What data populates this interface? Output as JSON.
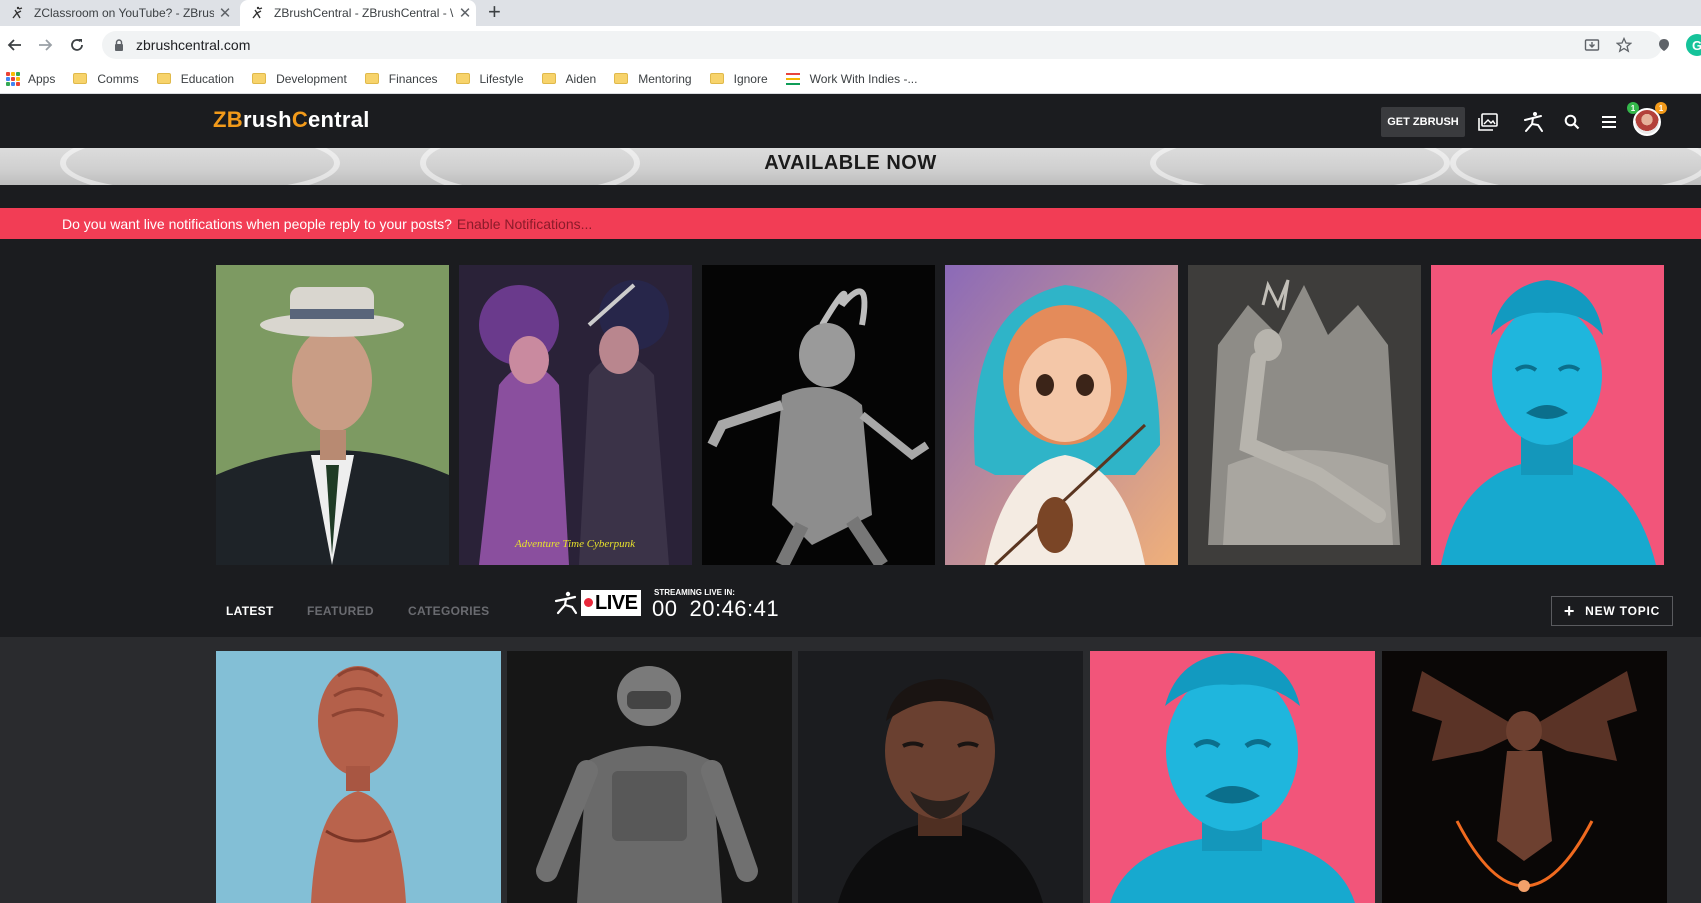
{
  "browser": {
    "tabs": [
      {
        "title": "ZClassroom on YouTube? - ZBrus",
        "active": false
      },
      {
        "title": "ZBrushCentral - ZBrushCentral - \\",
        "active": true
      }
    ],
    "new_tab": "+",
    "url": "zbrushcentral.com",
    "grammarly": "G",
    "bookmarks": {
      "apps": "Apps",
      "items": [
        "Comms",
        "Education",
        "Development",
        "Finances",
        "Lifestyle",
        "Aiden",
        "Mentoring",
        "Ignore"
      ],
      "sheet": "Work With Indies -..."
    }
  },
  "header": {
    "logo_left": "ZB",
    "logo_mid": "rush",
    "logo_c": "C",
    "logo_right": "entral",
    "get_zbrush": "GET ZBRUSH",
    "badges": [
      "1",
      "1"
    ],
    "colors": {
      "logo_accent": "#f29a1a",
      "badge_green": "#34b84b",
      "badge_orange": "#f29a1a"
    }
  },
  "banner": {
    "text": "AVAILABLE NOW"
  },
  "notification": {
    "question": "Do you want live notifications when people reply to your posts?",
    "link": "Enable Notifications..."
  },
  "gallery": {
    "items": [
      {
        "name": "portrait-man-hat"
      },
      {
        "name": "cyberpunk-women",
        "caption": "Adventure Time Cyberpunk"
      },
      {
        "name": "grey-demon-sculpt"
      },
      {
        "name": "violin-girl"
      },
      {
        "name": "throne-sculpt"
      },
      {
        "name": "blue-head-pink"
      }
    ]
  },
  "tabs": {
    "latest": "LATEST",
    "featured": "FEATURED",
    "categories": "CATEGORIES"
  },
  "live": {
    "logo": "LIVE",
    "label": "STREAMING LIVE IN:",
    "days": "00",
    "time": "20:46:41"
  },
  "new_topic": {
    "plus": "+",
    "label": "NEW TOPIC"
  },
  "colors": {
    "notify_bg": "#f23d55",
    "header_bg": "#1b1c1f",
    "latest_bg": "#2a2b2e"
  }
}
